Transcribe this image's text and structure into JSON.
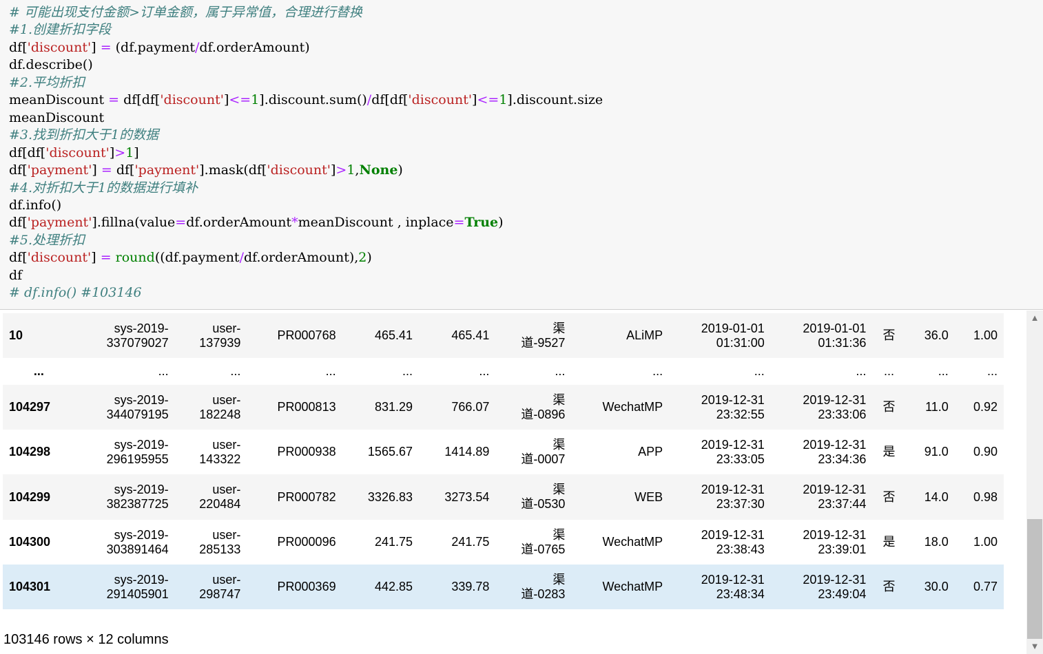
{
  "code": [
    [
      [
        "cm",
        "# 可能出现支付金额>订单金额，属于异常值，合理进行替换"
      ]
    ],
    [
      [
        "cm",
        "#1.创建折扣字段"
      ]
    ],
    [
      [
        "",
        "df["
      ],
      [
        "st",
        "'discount'"
      ],
      [
        "",
        "] "
      ],
      [
        "op",
        "="
      ],
      [
        "",
        ") (df.payment"
      ],
      [
        "op",
        "/"
      ],
      [
        "",
        "df.orderAmount)"
      ]
    ],
    [
      [
        "",
        "df.describe()"
      ]
    ],
    [
      [
        "cm",
        "#2.平均折扣"
      ]
    ],
    [
      [
        "",
        "meanDiscount "
      ],
      [
        "op",
        "="
      ],
      [
        "",
        " df[df["
      ],
      [
        "st",
        "'discount'"
      ],
      [
        "",
        "]"
      ],
      [
        "op",
        "<="
      ],
      [
        "nu",
        "1"
      ],
      [
        "",
        "].discount.sum()"
      ],
      [
        "op",
        "/"
      ],
      [
        "",
        "df[df["
      ],
      [
        "st",
        "'discount'"
      ],
      [
        "",
        "]"
      ],
      [
        "op",
        "<="
      ],
      [
        "nu",
        "1"
      ],
      [
        "",
        "].discount.size"
      ]
    ],
    [
      [
        "",
        "meanDiscount"
      ]
    ],
    [
      [
        "cm",
        "#3.找到折扣大于1的数据"
      ]
    ],
    [
      [
        "",
        "df[df["
      ],
      [
        "st",
        "'discount'"
      ],
      [
        "",
        "]"
      ],
      [
        "op",
        ">"
      ],
      [
        "nu",
        "1"
      ],
      [
        "",
        "]"
      ]
    ],
    [
      [
        "",
        "df["
      ],
      [
        "st",
        "'payment'"
      ],
      [
        "",
        "] "
      ],
      [
        "op",
        "="
      ],
      [
        "",
        " df["
      ],
      [
        "st",
        "'payment'"
      ],
      [
        "",
        "].mask(df["
      ],
      [
        "st",
        "'discount'"
      ],
      [
        "",
        "]"
      ],
      [
        "op",
        ">"
      ],
      [
        "nu",
        "1"
      ],
      [
        "",
        ","
      ],
      [
        "kw",
        "None"
      ],
      [
        "",
        ")"
      ]
    ],
    [
      [
        "cm",
        "#4.对折扣大于1的数据进行填补"
      ]
    ],
    [
      [
        "",
        "df.info()"
      ]
    ],
    [
      [
        "",
        "df["
      ],
      [
        "st",
        "'payment'"
      ],
      [
        "",
        "].fillna(value"
      ],
      [
        "op",
        "="
      ],
      [
        "",
        "df.orderAmount"
      ],
      [
        "op",
        "*"
      ],
      [
        "",
        "meanDiscount , inplace"
      ],
      [
        "op",
        "="
      ],
      [
        "kw",
        "True"
      ],
      [
        "",
        ")"
      ]
    ],
    [
      [
        "cm",
        "#5.处理折扣"
      ]
    ],
    [
      [
        "",
        "df["
      ],
      [
        "st",
        "'discount'"
      ],
      [
        "",
        "] "
      ],
      [
        "op",
        "="
      ],
      [
        " ",
        ""
      ],
      [
        "bi",
        "round"
      ],
      [
        "",
        "((df.payment"
      ],
      [
        "op",
        "/"
      ],
      [
        "",
        "df.orderAmount),"
      ],
      [
        "nu",
        "2"
      ],
      [
        "",
        ")"
      ]
    ],
    [
      [
        "",
        "df"
      ]
    ],
    [
      [
        "cm",
        "# df.info() #103146"
      ]
    ]
  ],
  "table": {
    "rows": [
      {
        "idx": "10",
        "c": [
          "sys-2019-\n337079027",
          "user-\n137939",
          "PR000768",
          "465.41",
          "465.41",
          "渠\n道-9527",
          "ALiMP",
          "2019-01-01\n01:31:00",
          "2019-01-01\n01:31:36",
          "否",
          "36.0",
          "1.00"
        ]
      },
      {
        "idx": "...",
        "c": [
          "...",
          "...",
          "...",
          "...",
          "...",
          "...",
          "...",
          "...",
          "...",
          "...",
          "...",
          "..."
        ]
      },
      {
        "idx": "104297",
        "c": [
          "sys-2019-\n344079195",
          "user-\n182248",
          "PR000813",
          "831.29",
          "766.07",
          "渠\n道-0896",
          "WechatMP",
          "2019-12-31\n23:32:55",
          "2019-12-31\n23:33:06",
          "否",
          "11.0",
          "0.92"
        ]
      },
      {
        "idx": "104298",
        "c": [
          "sys-2019-\n296195955",
          "user-\n143322",
          "PR000938",
          "1565.67",
          "1414.89",
          "渠\n道-0007",
          "APP",
          "2019-12-31\n23:33:05",
          "2019-12-31\n23:34:36",
          "是",
          "91.0",
          "0.90"
        ]
      },
      {
        "idx": "104299",
        "c": [
          "sys-2019-\n382387725",
          "user-\n220484",
          "PR000782",
          "3326.83",
          "3273.54",
          "渠\n道-0530",
          "WEB",
          "2019-12-31\n23:37:30",
          "2019-12-31\n23:37:44",
          "否",
          "14.0",
          "0.98"
        ]
      },
      {
        "idx": "104300",
        "c": [
          "sys-2019-\n303891464",
          "user-\n285133",
          "PR000096",
          "241.75",
          "241.75",
          "渠\n道-0765",
          "WechatMP",
          "2019-12-31\n23:38:43",
          "2019-12-31\n23:39:01",
          "是",
          "18.0",
          "1.00"
        ]
      },
      {
        "idx": "104301",
        "c": [
          "sys-2019-\n291405901",
          "user-\n298747",
          "PR000369",
          "442.85",
          "339.78",
          "渠\n道-0283",
          "WechatMP",
          "2019-12-31\n23:48:34",
          "2019-12-31\n23:49:04",
          "否",
          "30.0",
          "0.77"
        ]
      }
    ]
  },
  "footer": "103146 rows × 12 columns",
  "colors": {
    "comment": "#408080",
    "string": "#ba2121",
    "operator": "#aa22ff",
    "number": "#008000",
    "keyword": "#008000"
  }
}
